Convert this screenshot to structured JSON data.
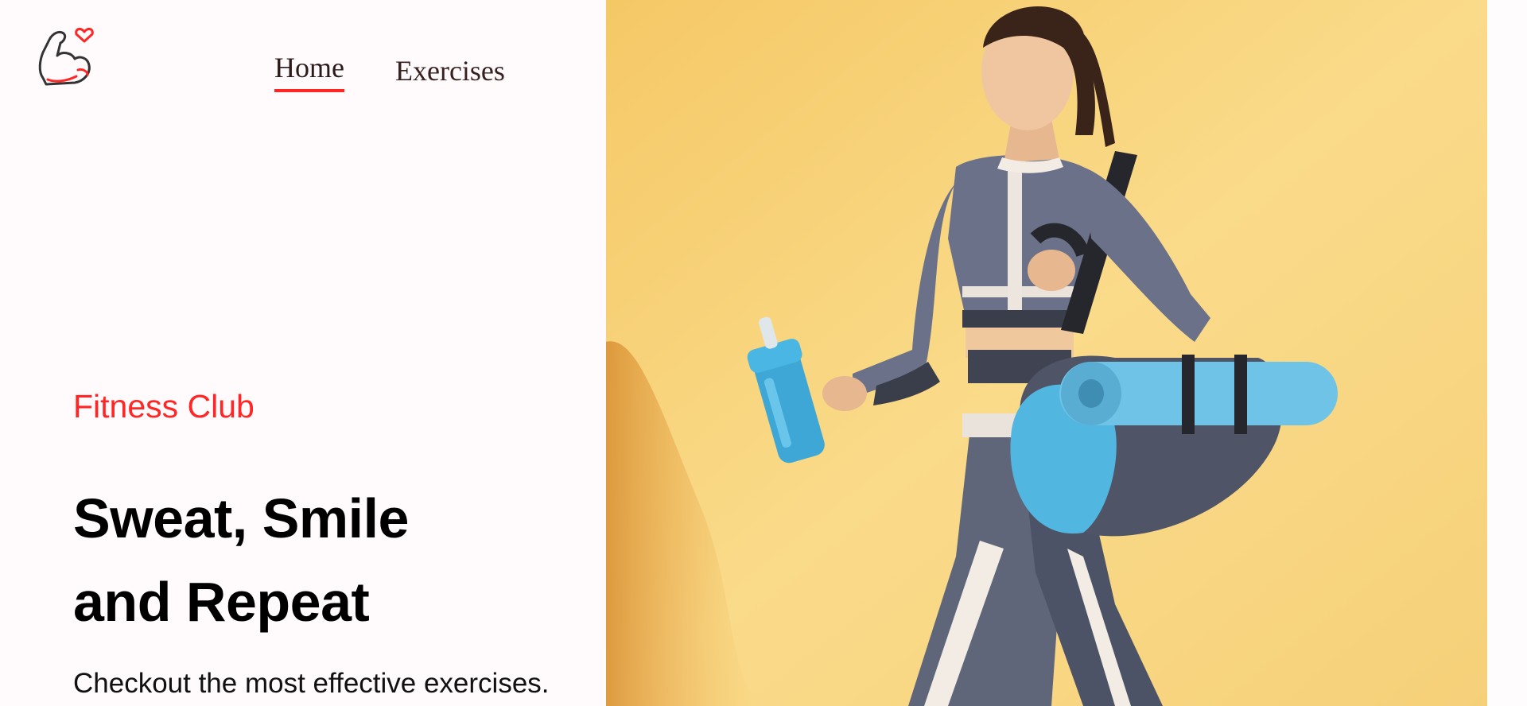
{
  "brand": {
    "logo_icon": "flexed-arm-heart-icon",
    "accent_color": "#ff2625"
  },
  "nav": {
    "items": [
      {
        "label": "Home",
        "active": true
      },
      {
        "label": "Exercises",
        "active": false
      }
    ]
  },
  "hero": {
    "eyebrow": "Fitness Club",
    "headline_line1": "Sweat, Smile",
    "headline_line2": "and Repeat",
    "subtitle": "Checkout the most effective exercises."
  },
  "banner": {
    "image_icon": "woman-with-gym-bag-and-bottle-photo",
    "background_color": "#f6cc6e"
  }
}
